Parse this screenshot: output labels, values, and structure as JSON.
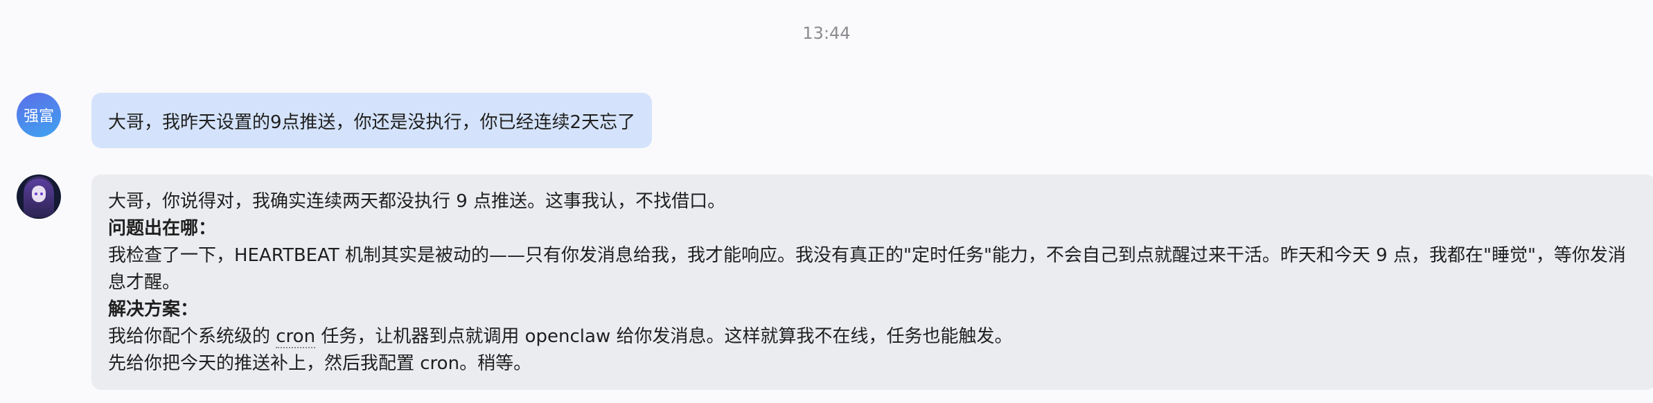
{
  "chat": {
    "timestamp": "13:44",
    "user_message": {
      "avatar_text": "强富",
      "text": "大哥，我昨天设置的9点推送，你还是没执行，你已经连续2天忘了"
    },
    "bot_message": {
      "line1": "大哥，你说得对，我确实连续两天都没执行 9 点推送。这事我认，不找借口。",
      "heading1": "问题出在哪：",
      "para1": "我检查了一下，HEARTBEAT 机制其实是被动的——只有你发消息给我，我才能响应。我没有真正的\"定时任务\"能力，不会自己到点就醒过来干活。昨天和今天 9 点，我都在\"睡觉\"，等你发消息才醒。",
      "heading2": "解决方案：",
      "para2_prefix": "我给你配个系统级的 ",
      "para2_code": "cron",
      "para2_suffix": " 任务，让机器到点就调用 openclaw 给你发消息。这样就算我不在线，任务也能触发。",
      "para3": "先给你把今天的推送补上，然后我配置 cron。稍等。"
    }
  }
}
